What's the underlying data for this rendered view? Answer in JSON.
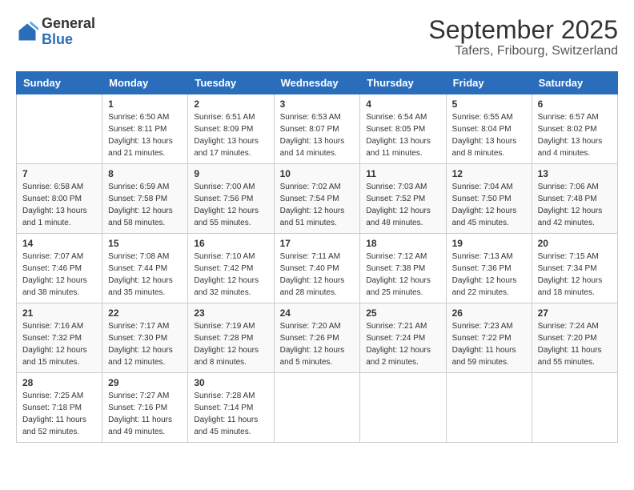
{
  "logo": {
    "general": "General",
    "blue": "Blue"
  },
  "header": {
    "title": "September 2025",
    "subtitle": "Tafers, Fribourg, Switzerland"
  },
  "days_of_week": [
    "Sunday",
    "Monday",
    "Tuesday",
    "Wednesday",
    "Thursday",
    "Friday",
    "Saturday"
  ],
  "weeks": [
    [
      {
        "num": "",
        "info": ""
      },
      {
        "num": "1",
        "info": "Sunrise: 6:50 AM\nSunset: 8:11 PM\nDaylight: 13 hours and 21 minutes."
      },
      {
        "num": "2",
        "info": "Sunrise: 6:51 AM\nSunset: 8:09 PM\nDaylight: 13 hours and 17 minutes."
      },
      {
        "num": "3",
        "info": "Sunrise: 6:53 AM\nSunset: 8:07 PM\nDaylight: 13 hours and 14 minutes."
      },
      {
        "num": "4",
        "info": "Sunrise: 6:54 AM\nSunset: 8:05 PM\nDaylight: 13 hours and 11 minutes."
      },
      {
        "num": "5",
        "info": "Sunrise: 6:55 AM\nSunset: 8:04 PM\nDaylight: 13 hours and 8 minutes."
      },
      {
        "num": "6",
        "info": "Sunrise: 6:57 AM\nSunset: 8:02 PM\nDaylight: 13 hours and 4 minutes."
      }
    ],
    [
      {
        "num": "7",
        "info": "Sunrise: 6:58 AM\nSunset: 8:00 PM\nDaylight: 13 hours and 1 minute."
      },
      {
        "num": "8",
        "info": "Sunrise: 6:59 AM\nSunset: 7:58 PM\nDaylight: 12 hours and 58 minutes."
      },
      {
        "num": "9",
        "info": "Sunrise: 7:00 AM\nSunset: 7:56 PM\nDaylight: 12 hours and 55 minutes."
      },
      {
        "num": "10",
        "info": "Sunrise: 7:02 AM\nSunset: 7:54 PM\nDaylight: 12 hours and 51 minutes."
      },
      {
        "num": "11",
        "info": "Sunrise: 7:03 AM\nSunset: 7:52 PM\nDaylight: 12 hours and 48 minutes."
      },
      {
        "num": "12",
        "info": "Sunrise: 7:04 AM\nSunset: 7:50 PM\nDaylight: 12 hours and 45 minutes."
      },
      {
        "num": "13",
        "info": "Sunrise: 7:06 AM\nSunset: 7:48 PM\nDaylight: 12 hours and 42 minutes."
      }
    ],
    [
      {
        "num": "14",
        "info": "Sunrise: 7:07 AM\nSunset: 7:46 PM\nDaylight: 12 hours and 38 minutes."
      },
      {
        "num": "15",
        "info": "Sunrise: 7:08 AM\nSunset: 7:44 PM\nDaylight: 12 hours and 35 minutes."
      },
      {
        "num": "16",
        "info": "Sunrise: 7:10 AM\nSunset: 7:42 PM\nDaylight: 12 hours and 32 minutes."
      },
      {
        "num": "17",
        "info": "Sunrise: 7:11 AM\nSunset: 7:40 PM\nDaylight: 12 hours and 28 minutes."
      },
      {
        "num": "18",
        "info": "Sunrise: 7:12 AM\nSunset: 7:38 PM\nDaylight: 12 hours and 25 minutes."
      },
      {
        "num": "19",
        "info": "Sunrise: 7:13 AM\nSunset: 7:36 PM\nDaylight: 12 hours and 22 minutes."
      },
      {
        "num": "20",
        "info": "Sunrise: 7:15 AM\nSunset: 7:34 PM\nDaylight: 12 hours and 18 minutes."
      }
    ],
    [
      {
        "num": "21",
        "info": "Sunrise: 7:16 AM\nSunset: 7:32 PM\nDaylight: 12 hours and 15 minutes."
      },
      {
        "num": "22",
        "info": "Sunrise: 7:17 AM\nSunset: 7:30 PM\nDaylight: 12 hours and 12 minutes."
      },
      {
        "num": "23",
        "info": "Sunrise: 7:19 AM\nSunset: 7:28 PM\nDaylight: 12 hours and 8 minutes."
      },
      {
        "num": "24",
        "info": "Sunrise: 7:20 AM\nSunset: 7:26 PM\nDaylight: 12 hours and 5 minutes."
      },
      {
        "num": "25",
        "info": "Sunrise: 7:21 AM\nSunset: 7:24 PM\nDaylight: 12 hours and 2 minutes."
      },
      {
        "num": "26",
        "info": "Sunrise: 7:23 AM\nSunset: 7:22 PM\nDaylight: 11 hours and 59 minutes."
      },
      {
        "num": "27",
        "info": "Sunrise: 7:24 AM\nSunset: 7:20 PM\nDaylight: 11 hours and 55 minutes."
      }
    ],
    [
      {
        "num": "28",
        "info": "Sunrise: 7:25 AM\nSunset: 7:18 PM\nDaylight: 11 hours and 52 minutes."
      },
      {
        "num": "29",
        "info": "Sunrise: 7:27 AM\nSunset: 7:16 PM\nDaylight: 11 hours and 49 minutes."
      },
      {
        "num": "30",
        "info": "Sunrise: 7:28 AM\nSunset: 7:14 PM\nDaylight: 11 hours and 45 minutes."
      },
      {
        "num": "",
        "info": ""
      },
      {
        "num": "",
        "info": ""
      },
      {
        "num": "",
        "info": ""
      },
      {
        "num": "",
        "info": ""
      }
    ]
  ]
}
